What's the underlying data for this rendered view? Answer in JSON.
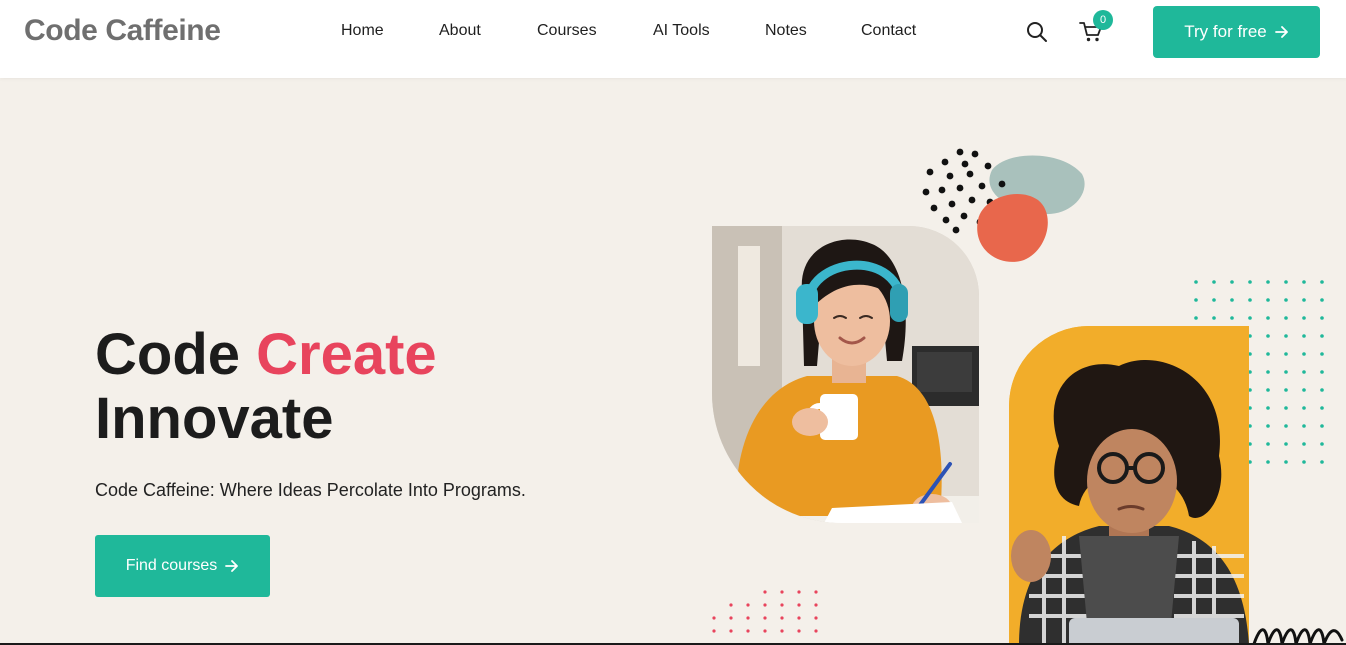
{
  "brand": {
    "name": "Code Caffeine"
  },
  "nav": {
    "items": [
      {
        "label": "Home"
      },
      {
        "label": "About"
      },
      {
        "label": "Courses"
      },
      {
        "label": "AI Tools"
      },
      {
        "label": "Notes"
      },
      {
        "label": "Contact"
      }
    ]
  },
  "header": {
    "search_icon": "search-icon",
    "cart_icon": "cart-icon",
    "cart_count": "0",
    "cta_label": "Try for free"
  },
  "hero": {
    "title_word1": "Code",
    "title_word2": "Create",
    "title_line2": "Innovate",
    "subtitle": "Code Caffeine: Where Ideas Percolate Into Programs.",
    "cta_label": "Find courses"
  },
  "colors": {
    "accent": "#1fb89a",
    "highlight": "#e8445d",
    "background": "#f4f0ea",
    "orange": "#f1ab2a",
    "coral": "#e8674c",
    "sage": "#a9c1bc"
  }
}
